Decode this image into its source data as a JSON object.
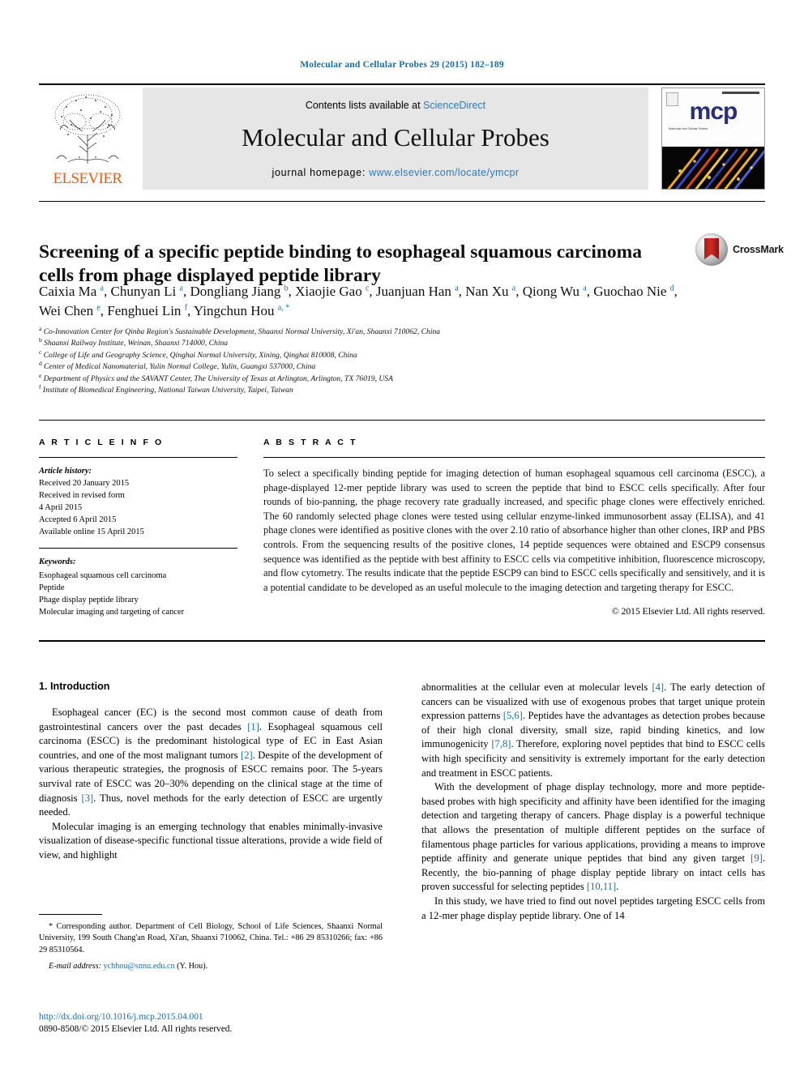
{
  "running_head": "Molecular and Cellular Probes 29 (2015) 182–189",
  "masthead": {
    "publisher_name": "ELSEVIER",
    "contents_prefix": "Contents lists available at ",
    "contents_link": "ScienceDirect",
    "journal_title": "Molecular and Cellular Probes",
    "homepage_prefix": "journal homepage: ",
    "homepage_url": "www.elsevier.com/locate/ymcpr",
    "cover_mark": "mcp",
    "cover_sub": "Molecular and Cellular Probes"
  },
  "article": {
    "title": "Screening of a specific peptide binding to esophageal squamous carcinoma cells from phage displayed peptide library",
    "crossmark_label": "CrossMark",
    "authors": [
      {
        "name": "Caixia Ma",
        "sup": "a",
        "sep": ", "
      },
      {
        "name": "Chunyan Li",
        "sup": "a",
        "sep": ", "
      },
      {
        "name": "Dongliang Jiang",
        "sup": "b",
        "sep": ", "
      },
      {
        "name": "Xiaojie Gao",
        "sup": "c",
        "sep": ", "
      },
      {
        "name": "Juanjuan Han",
        "sup": "a",
        "sep": ", "
      },
      {
        "name": "Nan Xu",
        "sup": "a",
        "sep": ", "
      },
      {
        "name": "Qiong Wu",
        "sup": "a",
        "sep": ", "
      },
      {
        "name": "Guochao Nie",
        "sup": "d",
        "sep": ", "
      },
      {
        "name": "Wei Chen",
        "sup": "e",
        "sep": ", "
      },
      {
        "name": "Fenghuei Lin",
        "sup": "f",
        "sep": ", "
      },
      {
        "name": "Yingchun Hou",
        "sup": "a, *",
        "sep": ""
      }
    ],
    "affiliations": [
      {
        "marker": "a",
        "text": "Co-Innovation Center for Qinba Region's Sustainable Development, Shaanxi Normal University, Xi'an, Shaanxi 710062, China"
      },
      {
        "marker": "b",
        "text": "Shaanxi Railway Institute, Weinan, Shaanxi 714000, China"
      },
      {
        "marker": "c",
        "text": "College of Life and Geography Science, Qinghai Normal University, Xining, Qinghai 810008, China"
      },
      {
        "marker": "d",
        "text": "Center of Medical Nanomaterial, Yulin Normal College, Yulin, Guangxi 537000, China"
      },
      {
        "marker": "e",
        "text": "Department of Physics and the SAVANT Center, The University of Texas at Arlington, Arlington, TX 76019, USA"
      },
      {
        "marker": "f",
        "text": "Institute of Biomedical Engineering, National Taiwan University, Taipei, Taiwan"
      }
    ]
  },
  "article_info": {
    "heading": "A R T I C L E   I N F O",
    "history_label": "Article history:",
    "history": [
      "Received 20 January 2015",
      "Received in revised form",
      "4 April 2015",
      "Accepted 6 April 2015",
      "Available online 15 April 2015"
    ],
    "keywords_label": "Keywords:",
    "keywords": [
      "Esophageal squamous cell carcinoma",
      "Peptide",
      "Phage display peptide library",
      "Molecular imaging and targeting of cancer"
    ]
  },
  "abstract": {
    "heading": "A B S T R A C T",
    "body": "To select a specifically binding peptide for imaging detection of human esophageal squamous cell carcinoma (ESCC), a phage-displayed 12-mer peptide library was used to screen the peptide that bind to ESCC cells specifically. After four rounds of bio-panning, the phage recovery rate gradually increased, and specific phage clones were effectively enriched. The 60 randomly selected phage clones were tested using cellular enzyme-linked immunosorbent assay (ELISA), and 41 phage clones were identified as positive clones with the over 2.10 ratio of absorbance higher than other clones, IRP and PBS controls. From the sequencing results of the positive clones, 14 peptide sequences were obtained and ESCP9 consensus sequence was identified as the peptide with best affinity to ESCC cells via competitive inhibition, fluorescence microscopy, and flow cytometry. The results indicate that the peptide ESCP9 can bind to ESCC cells specifically and sensitively, and it is a potential candidate to be developed as an useful molecule to the imaging detection and targeting therapy for ESCC.",
    "copyright": "© 2015 Elsevier Ltd. All rights reserved."
  },
  "introduction": {
    "heading": "1. Introduction",
    "left_paragraphs": [
      {
        "parts": [
          {
            "t": "Esophageal cancer (EC) is the second most common cause of death from gastrointestinal cancers over the past decades "
          },
          {
            "t": "[1]",
            "ref": true
          },
          {
            "t": ". Esophageal squamous cell carcinoma (ESCC) is the predominant histological type of EC in East Asian countries, and one of the most malignant tumors "
          },
          {
            "t": "[2]",
            "ref": true
          },
          {
            "t": ". Despite of the development of various therapeutic strategies, the prognosis of ESCC remains poor. The 5-years survival rate of ESCC was 20–30% depending on the clinical stage at the time of diagnosis "
          },
          {
            "t": "[3]",
            "ref": true
          },
          {
            "t": ". Thus, novel methods for the early detection of ESCC are urgently needed."
          }
        ]
      },
      {
        "parts": [
          {
            "t": "Molecular imaging is an emerging technology that enables minimally-invasive visualization of disease-specific functional tissue alterations, provide a wide field of view, and highlight"
          }
        ]
      }
    ],
    "right_paragraphs": [
      {
        "parts": [
          {
            "t": "abnormalities at the cellular even at molecular levels "
          },
          {
            "t": "[4]",
            "ref": true
          },
          {
            "t": ". The early detection of cancers can be visualized with use of exogenous probes that target unique protein expression patterns "
          },
          {
            "t": "[5,6]",
            "ref": true
          },
          {
            "t": ". Peptides have the advantages as detection probes because of their high clonal diversity, small size, rapid binding kinetics, and low immunogenicity "
          },
          {
            "t": "[7,8]",
            "ref": true
          },
          {
            "t": ". Therefore, exploring novel peptides that bind to ESCC cells with high specificity and sensitivity is extremely important for the early detection and treatment in ESCC patients."
          }
        ],
        "no_indent": true
      },
      {
        "parts": [
          {
            "t": "With the development of phage display technology, more and more peptide-based probes with high specificity and affinity have been identified for the imaging detection and targeting therapy of cancers. Phage display is a powerful technique that allows the presentation of multiple different peptides on the surface of filamentous phage particles for various applications, providing a means to improve peptide affinity and generate unique peptides that bind any given target "
          },
          {
            "t": "[9]",
            "ref": true
          },
          {
            "t": ". Recently, the bio-panning of phage display peptide library on intact cells has proven successful for selecting peptides "
          },
          {
            "t": "[10,11]",
            "ref": true
          },
          {
            "t": "."
          }
        ]
      },
      {
        "parts": [
          {
            "t": "In this study, we have tried to find out novel peptides targeting ESCC cells from a 12-mer phage display peptide library. One of 14"
          }
        ]
      }
    ]
  },
  "footnotes": {
    "corresponding": "* Corresponding author. Department of Cell Biology, School of Life Sciences, Shaanxi Normal University, 199 South Chang'an Road, Xi'an, Shaanxi 710062, China. Tel.: +86 29 85310266; fax: +86 29 85310564.",
    "email_label": "E-mail address:",
    "email_address": "ychhou@snnu.edu.cn",
    "email_suffix": " (Y. Hou)."
  },
  "footer": {
    "doi": "http://dx.doi.org/10.1016/j.mcp.2015.04.001",
    "issn": "0890-8508/© 2015 Elsevier Ltd. All rights reserved."
  },
  "colors": {
    "link": "#1a6ea5",
    "sciencedirect": "#2b7bb9",
    "elsevier_orange": "#e85d13",
    "band_gray": "#e6e6e6"
  }
}
